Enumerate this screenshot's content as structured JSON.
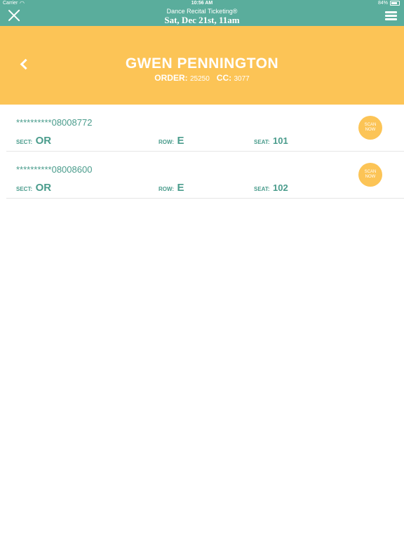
{
  "status_bar": {
    "carrier": "Carrier",
    "time": "10:56 AM",
    "battery": "84%"
  },
  "header": {
    "app_name": "Dance Recital Ticketing®",
    "event_date": "Sat, Dec 21st, 11am",
    "close_icon": "close-icon",
    "menu_icon": "hamburger-menu-icon"
  },
  "banner": {
    "customer_name": "GWEN PENNINGTON",
    "order_label": "ORDER:",
    "order_value": "25250",
    "cc_label": "CC:",
    "cc_value": "3077",
    "back_icon": "chevron-left-icon"
  },
  "tickets": [
    {
      "number": "**********08008772",
      "sect_label": "SECT:",
      "sect_value": "OR",
      "row_label": "ROW:",
      "row_value": "E",
      "seat_label": "SEAT:",
      "seat_value": "101",
      "scan_label": "SCAN NOW"
    },
    {
      "number": "**********08008600",
      "sect_label": "SECT:",
      "sect_value": "OR",
      "row_label": "ROW:",
      "row_value": "E",
      "seat_label": "SEAT:",
      "seat_value": "102",
      "scan_label": "SCAN NOW"
    }
  ],
  "colors": {
    "header_teal": "#5aad9c",
    "banner_yellow": "#fcc456",
    "text_teal": "#4a9c8c"
  }
}
